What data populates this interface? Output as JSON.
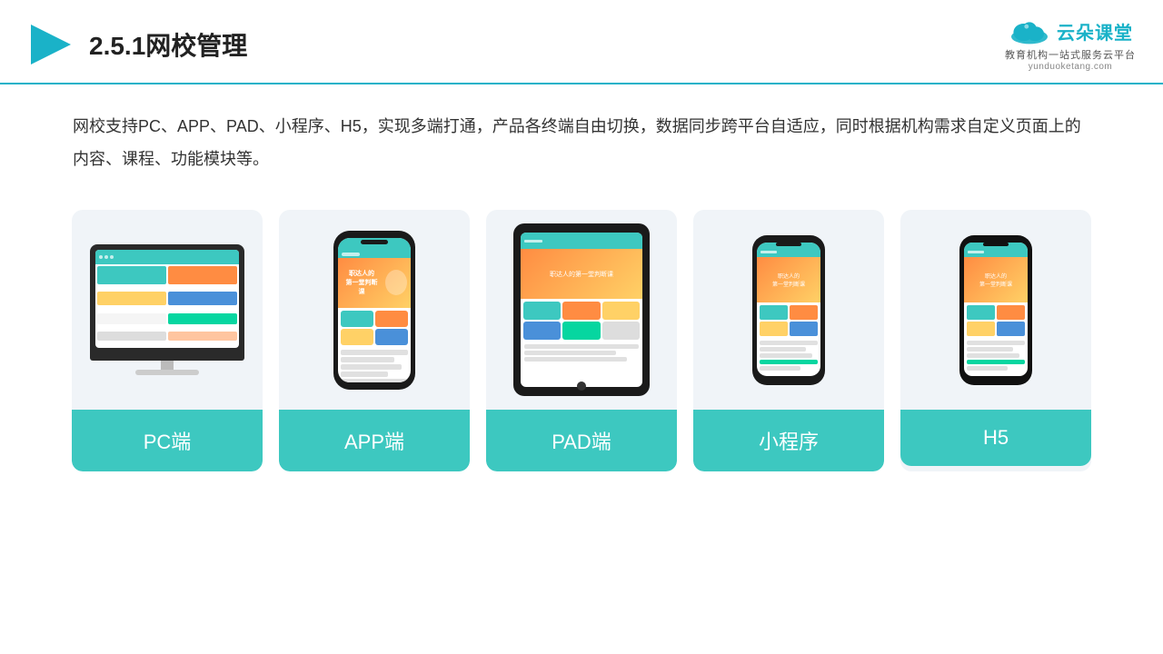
{
  "header": {
    "title": "2.5.1网校管理",
    "logo_name": "云朵课堂",
    "logo_url": "yunduoketang.com",
    "logo_tagline": "教育机构一站式服务云平台"
  },
  "description": "网校支持PC、APP、PAD、小程序、H5，实现多端打通，产品各终端自由切换，数据同步跨平台自适应，同时根据机构需求自定义页面上的内容、课程、功能模块等。",
  "cards": [
    {
      "id": "pc",
      "label": "PC端"
    },
    {
      "id": "app",
      "label": "APP端"
    },
    {
      "id": "pad",
      "label": "PAD端"
    },
    {
      "id": "miniapp",
      "label": "小程序"
    },
    {
      "id": "h5",
      "label": "H5"
    }
  ]
}
